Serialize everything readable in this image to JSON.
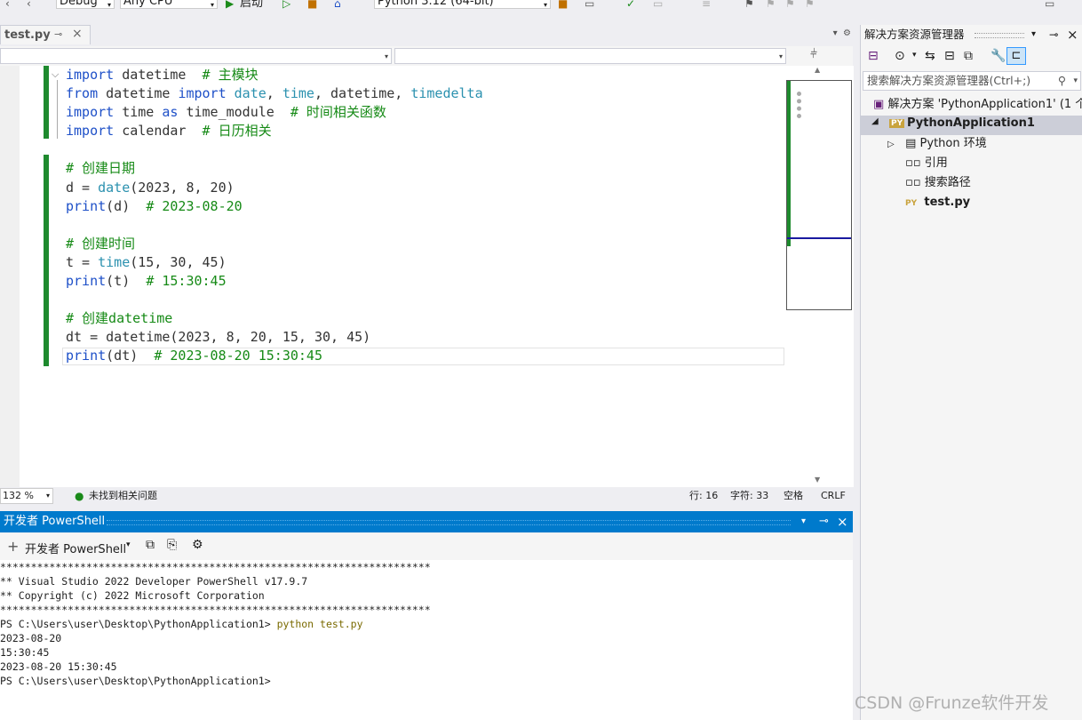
{
  "toolbar": {
    "config": "Debug",
    "platform": "Any CPU",
    "start_label": "启动",
    "environment": "Python 3.12 (64-bit)"
  },
  "document_tab": {
    "name": "test.py"
  },
  "code_lines": [
    [
      {
        "t": "import",
        "c": "kw"
      },
      {
        "t": " datetime  ",
        "c": "nm"
      },
      {
        "t": "# 主模块",
        "c": "cm"
      }
    ],
    [
      {
        "t": "from",
        "c": "kw"
      },
      {
        "t": " datetime ",
        "c": "nm"
      },
      {
        "t": "import",
        "c": "kw"
      },
      {
        "t": " ",
        "c": "nm"
      },
      {
        "t": "date",
        "c": "ty"
      },
      {
        "t": ", ",
        "c": "nm"
      },
      {
        "t": "time",
        "c": "ty"
      },
      {
        "t": ", datetime, ",
        "c": "nm"
      },
      {
        "t": "timedelta",
        "c": "ty"
      }
    ],
    [
      {
        "t": "import",
        "c": "kw"
      },
      {
        "t": " time ",
        "c": "nm"
      },
      {
        "t": "as",
        "c": "kw"
      },
      {
        "t": " time_module  ",
        "c": "nm"
      },
      {
        "t": "# 时间相关函数",
        "c": "cm"
      }
    ],
    [
      {
        "t": "import",
        "c": "kw"
      },
      {
        "t": " calendar  ",
        "c": "nm"
      },
      {
        "t": "# 日历相关",
        "c": "cm"
      }
    ],
    [],
    [
      {
        "t": "# 创建日期",
        "c": "cm"
      }
    ],
    [
      {
        "t": "d = ",
        "c": "nm"
      },
      {
        "t": "date",
        "c": "ty"
      },
      {
        "t": "(2023, 8, 20)",
        "c": "nm"
      }
    ],
    [
      {
        "t": "print",
        "c": "kw"
      },
      {
        "t": "(d)  ",
        "c": "nm"
      },
      {
        "t": "# 2023-08-20",
        "c": "cm"
      }
    ],
    [],
    [
      {
        "t": "# 创建时间",
        "c": "cm"
      }
    ],
    [
      {
        "t": "t = ",
        "c": "nm"
      },
      {
        "t": "time",
        "c": "ty"
      },
      {
        "t": "(15, 30, 45)",
        "c": "nm"
      }
    ],
    [
      {
        "t": "print",
        "c": "kw"
      },
      {
        "t": "(t)  ",
        "c": "nm"
      },
      {
        "t": "# 15:30:45",
        "c": "cm"
      }
    ],
    [],
    [
      {
        "t": "# 创建datetime",
        "c": "cm"
      }
    ],
    [
      {
        "t": "dt = datetime(2023, 8, 20, 15, 30, 45)",
        "c": "nm"
      }
    ],
    [
      {
        "t": "print",
        "c": "kw"
      },
      {
        "t": "(dt)  ",
        "c": "nm"
      },
      {
        "t": "# 2023-08-20 15:30:45",
        "c": "cm"
      }
    ]
  ],
  "editor_status": {
    "zoom": "132 %",
    "issues": "未找到相关问题",
    "line": "行: 16",
    "char": "字符: 33",
    "whitespace": "空格",
    "line_ending": "CRLF"
  },
  "powershell": {
    "title": "开发者 PowerShell",
    "toolbar_label": "开发者 PowerShell",
    "console_lines": [
      "**********************************************************************",
      "** Visual Studio 2022 Developer PowerShell v17.9.7",
      "** Copyright (c) 2022 Microsoft Corporation",
      "**********************************************************************",
      "PS C:\\Users\\user\\Desktop\\PythonApplication1> ",
      "2023-08-20",
      "15:30:45",
      "2023-08-20 15:30:45",
      "PS C:\\Users\\user\\Desktop\\PythonApplication1>"
    ],
    "command": "python test.py"
  },
  "solution_explorer": {
    "title": "解决方案资源管理器",
    "search_placeholder": "搜索解决方案资源管理器(Ctrl+;)",
    "solution_label": "解决方案 'PythonApplication1' (1 个",
    "project": "PythonApplication1",
    "items": [
      "Python 环境",
      "引用",
      "搜索路径",
      "test.py"
    ]
  },
  "watermark": "CSDN @Frunze软件开发",
  "colors": {
    "accent": "#007acc",
    "keyword": "#1e50c8",
    "comment": "#168a16",
    "type": "#2b91af",
    "change_bar": "#1e8a2e"
  }
}
